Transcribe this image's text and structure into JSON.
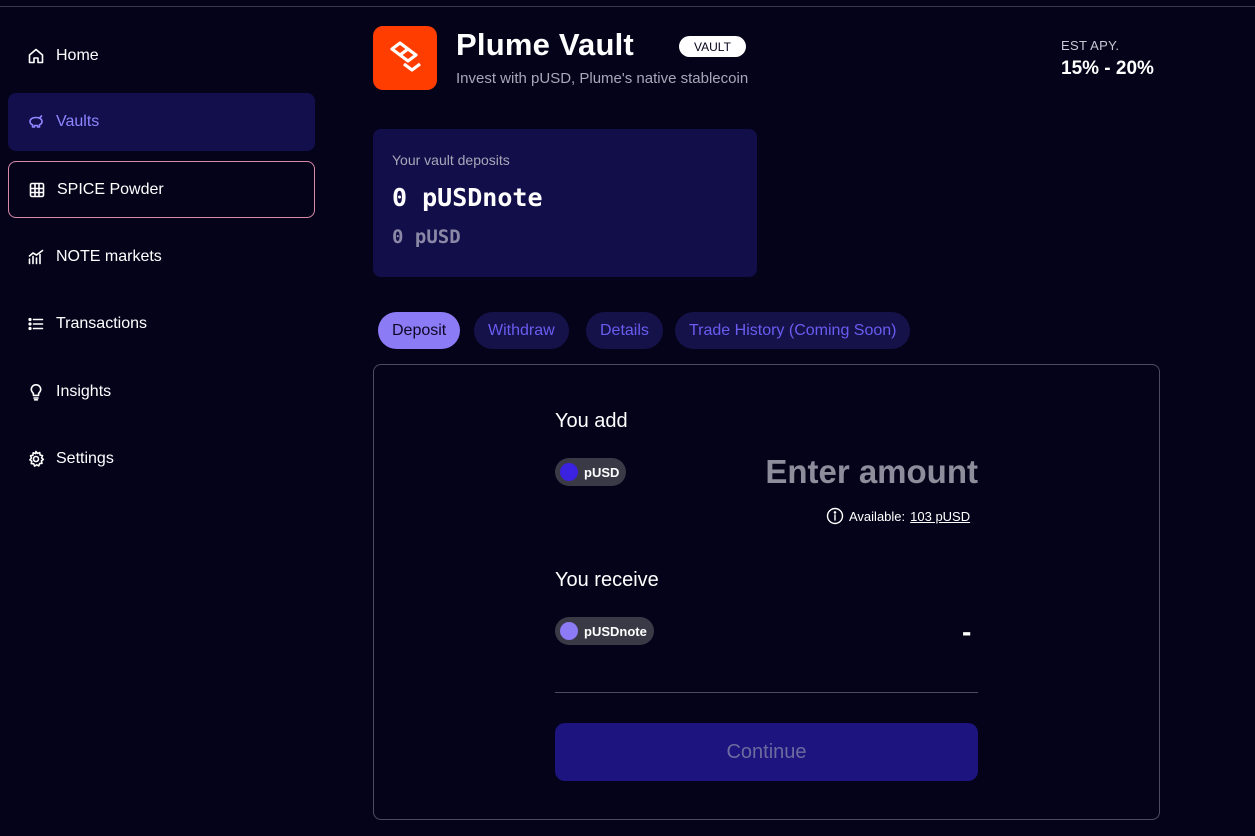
{
  "sidebar": {
    "items": [
      {
        "label": "Home",
        "icon": "home-icon"
      },
      {
        "label": "Vaults",
        "icon": "piggy-bank-icon"
      },
      {
        "label": "SPICE Powder",
        "icon": "grid-icon"
      },
      {
        "label": "NOTE markets",
        "icon": "chart-icon"
      },
      {
        "label": "Transactions",
        "icon": "list-icon"
      },
      {
        "label": "Insights",
        "icon": "lightbulb-icon"
      },
      {
        "label": "Settings",
        "icon": "gear-icon"
      }
    ],
    "active": "Vaults"
  },
  "header": {
    "title": "Plume Vault",
    "badge": "VAULT",
    "subtitle": "Invest with pUSD, Plume's native stablecoin",
    "apy_label": "EST APY.",
    "apy_value": "15% - 20%",
    "logo_color": "#ff3d00"
  },
  "deposits": {
    "label": "Your vault deposits",
    "note_amount": "0 pUSDnote",
    "usd_amount": "0 pUSD"
  },
  "tabs": [
    {
      "label": "Deposit",
      "active": true
    },
    {
      "label": "Withdraw",
      "active": false
    },
    {
      "label": "Details",
      "active": false
    },
    {
      "label": "Trade History (Coming Soon)",
      "active": false
    }
  ],
  "form": {
    "add_label": "You add",
    "add_token": "pUSD",
    "amount_placeholder": "Enter amount",
    "available_label": "Available:",
    "available_value": "103 pUSD",
    "receive_label": "You receive",
    "receive_token": "pUSDnote",
    "receive_value": "-",
    "continue_label": "Continue"
  },
  "colors": {
    "background": "#05031a",
    "accent": "#8b7bf5",
    "pusd_dot": "#3a22e0",
    "pusdnote_dot": "#8b7bf5"
  }
}
